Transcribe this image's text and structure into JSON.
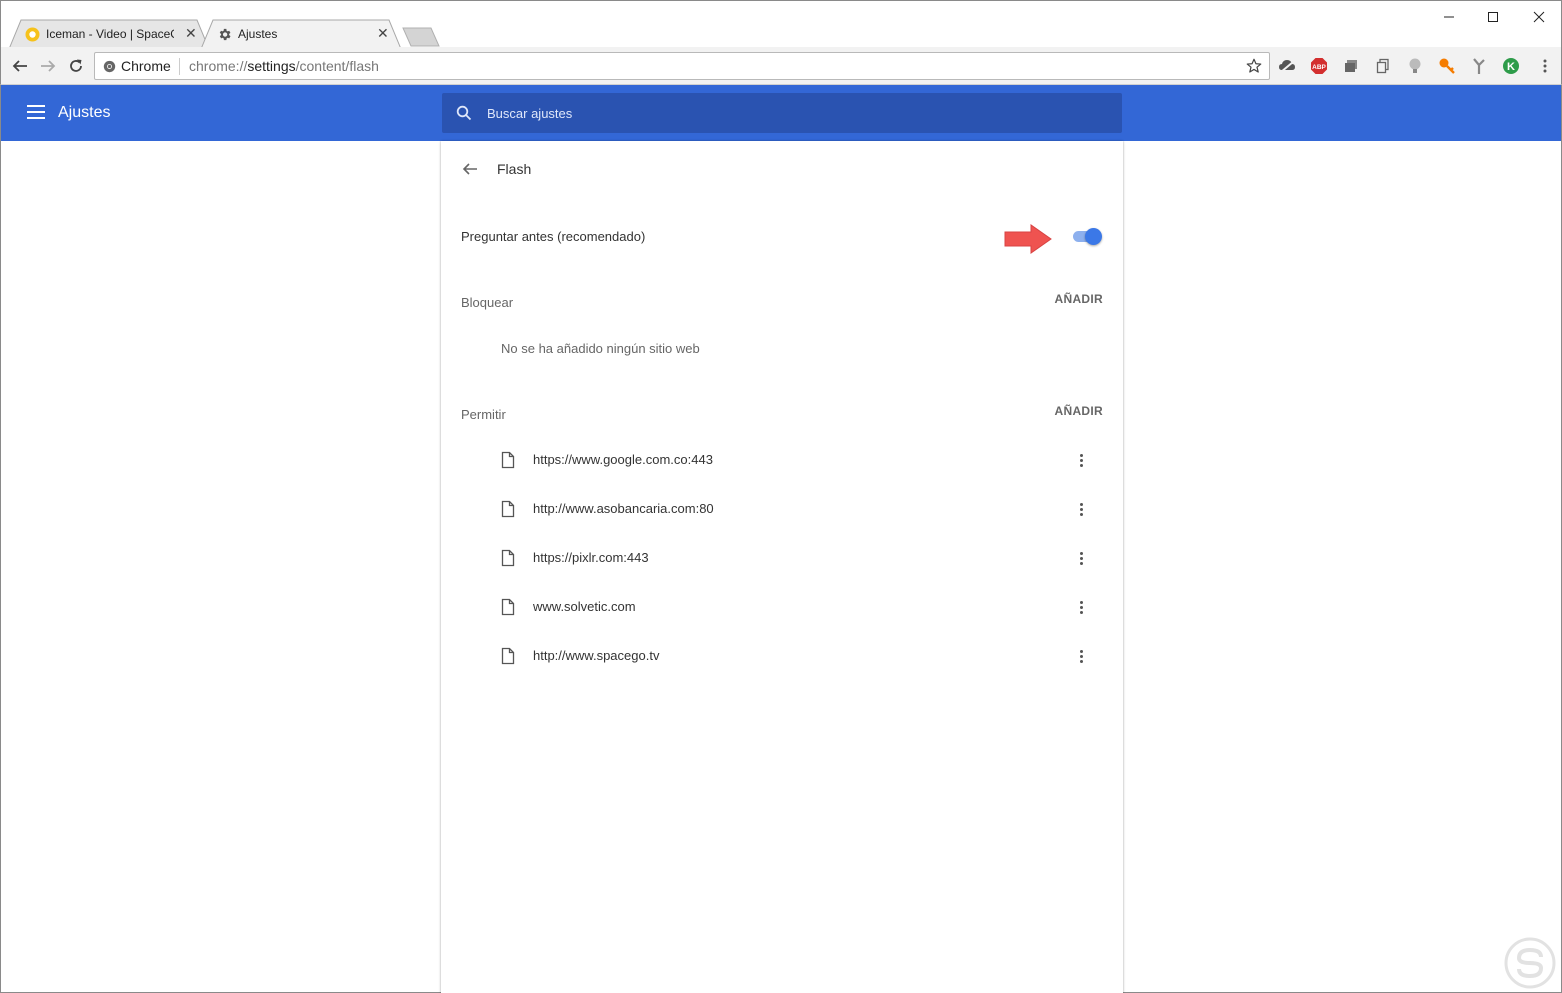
{
  "browser": {
    "tabs": [
      {
        "title": "Iceman - Video | SpaceG",
        "close": "✕"
      },
      {
        "title": "Ajustes",
        "close": "✕"
      }
    ],
    "omnibox": {
      "chip": "Chrome",
      "url_scheme": "chrome://",
      "url_host": "settings",
      "url_path": "/content/flash"
    },
    "extensions": [
      "cloud-icon",
      "adblock-plus-icon",
      "stack-icon",
      "copy-icon",
      "bulb-icon",
      "key-icon",
      "branch-icon",
      "k-icon"
    ],
    "adblock_badge": "ABP",
    "k_badge": "K"
  },
  "header": {
    "title": "Ajustes",
    "search_placeholder": "Buscar ajustes"
  },
  "flash": {
    "title": "Flash",
    "ask_label": "Preguntar antes (recomendado)",
    "ask_enabled": true,
    "block": {
      "label": "Bloquear",
      "add": "AÑADIR",
      "empty": "No se ha añadido ningún sitio web"
    },
    "allow": {
      "label": "Permitir",
      "add": "AÑADIR",
      "sites": [
        "https://www.google.com.co:443",
        "http://www.asobancaria.com:80",
        "https://pixlr.com:443",
        "www.solvetic.com",
        "http://www.spacego.tv"
      ]
    }
  },
  "colors": {
    "header_blue": "#3367d6",
    "search_blue": "#2a53b1",
    "toggle_blue": "#3b78e7",
    "arrow_red": "#ef5350"
  }
}
